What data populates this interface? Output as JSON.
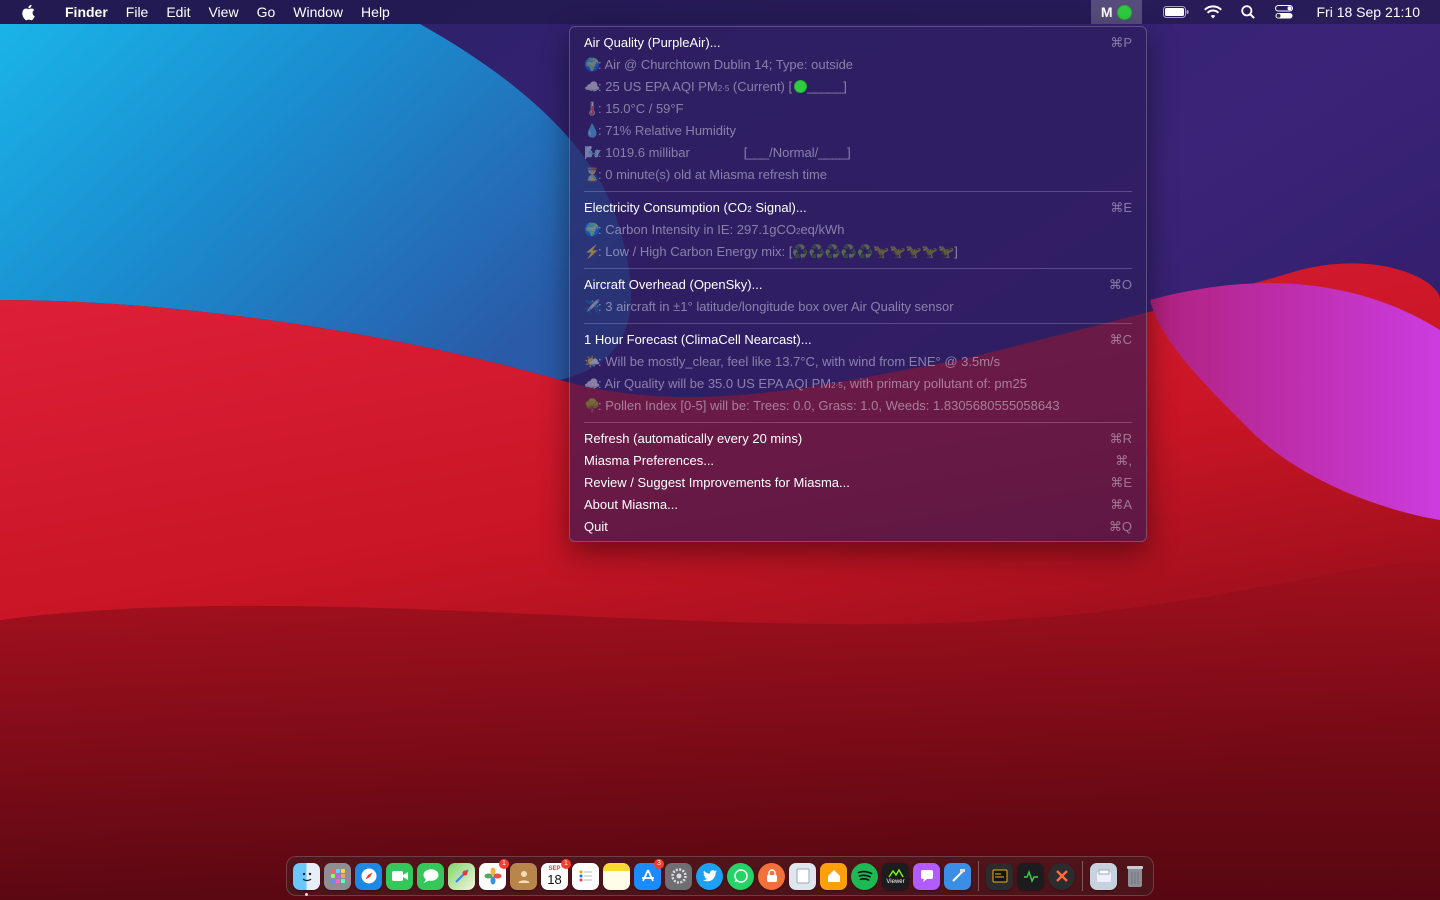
{
  "menubar": {
    "app_name": "Finder",
    "menus": [
      "File",
      "Edit",
      "View",
      "Go",
      "Window",
      "Help"
    ],
    "status_app_letter": "M",
    "clock": "Fri 18 Sep  21:10"
  },
  "menu": {
    "air_quality": {
      "title": "Air Quality (PurpleAir)...",
      "shortcut": "⌘P",
      "location": ": Air @ Churchtown Dublin 14; Type: outside",
      "aqi_pre": ": 25 US EPA AQI PM",
      "aqi_sub": "2·5",
      "aqi_post": " (Current)   [",
      "aqi_bar_end": "_____]",
      "temperature": ": 15.0°C / 59°F",
      "humidity": ": 71% Relative Humidity",
      "pressure": ": 1019.6 millibar",
      "pressure_scale": "[___/Normal/____]",
      "age": ": 0 minute(s) old at Miasma refresh time"
    },
    "electricity": {
      "title_pre": "Electricity Consumption (CO",
      "title_sub": "2",
      "title_post": " Signal)...",
      "shortcut": "⌘E",
      "intensity_pre": ": Carbon Intensity in IE: 297.1gCO",
      "intensity_sub": "2",
      "intensity_post": "eq/kWh",
      "mix_label": ": Low / High Carbon Energy mix: [",
      "mix_icons": "♻️♻️♻️♻️♻️🦖🦖🦖🦖🦖",
      "mix_end": "]"
    },
    "aircraft": {
      "title": "Aircraft Overhead (OpenSky)...",
      "shortcut": "⌘O",
      "count": ": 3 aircraft in ±1° latitude/longitude box over Air Quality sensor"
    },
    "forecast": {
      "title": "1 Hour Forecast (ClimaCell Nearcast)...",
      "shortcut": "⌘C",
      "weather": ": Will be mostly_clear, feel like 13.7°C, with wind from ENE° @ 3.5m/s",
      "aq_pre": ": Air Quality will be 35.0 US EPA AQI PM",
      "aq_sub": "2·5",
      "aq_post": ", with primary pollutant of: pm25",
      "pollen": ": Pollen Index [0-5] will be: Trees: 0.0, Grass: 1.0, Weeds: 1.8305680555058643"
    },
    "actions": [
      {
        "label": "Refresh (automatically every 20 mins)",
        "shortcut": "⌘R"
      },
      {
        "label": "Miasma Preferences...",
        "shortcut": "⌘,"
      },
      {
        "label": "Review / Suggest Improvements for Miasma...",
        "shortcut": "⌘E"
      },
      {
        "label": "About Miasma...",
        "shortcut": "⌘A"
      },
      {
        "label": "Quit",
        "shortcut": "⌘Q"
      }
    ]
  },
  "emojis": {
    "globe": "🌍",
    "cloud": "☁️",
    "thermometer": "🌡️",
    "droplet": "💧",
    "wind": "🌬️",
    "hourglass": "⏳",
    "bolt": "⚡",
    "plane": "✈️",
    "sun_cloud": "🌤️",
    "tree": "🌳"
  },
  "dock": {
    "calendar_month": "SEP",
    "calendar_day": "18",
    "badges": {
      "photos": "1",
      "calendar": "1",
      "appstore": "3"
    },
    "viewer_label": "Viewer"
  },
  "colors": {
    "menu_bg": "#2c1c58",
    "status_green": "#2ecc40",
    "wallpaper_blue": "#1c9fd6",
    "wallpaper_red": "#d01a2a",
    "wallpaper_purple": "#2a1d63"
  }
}
